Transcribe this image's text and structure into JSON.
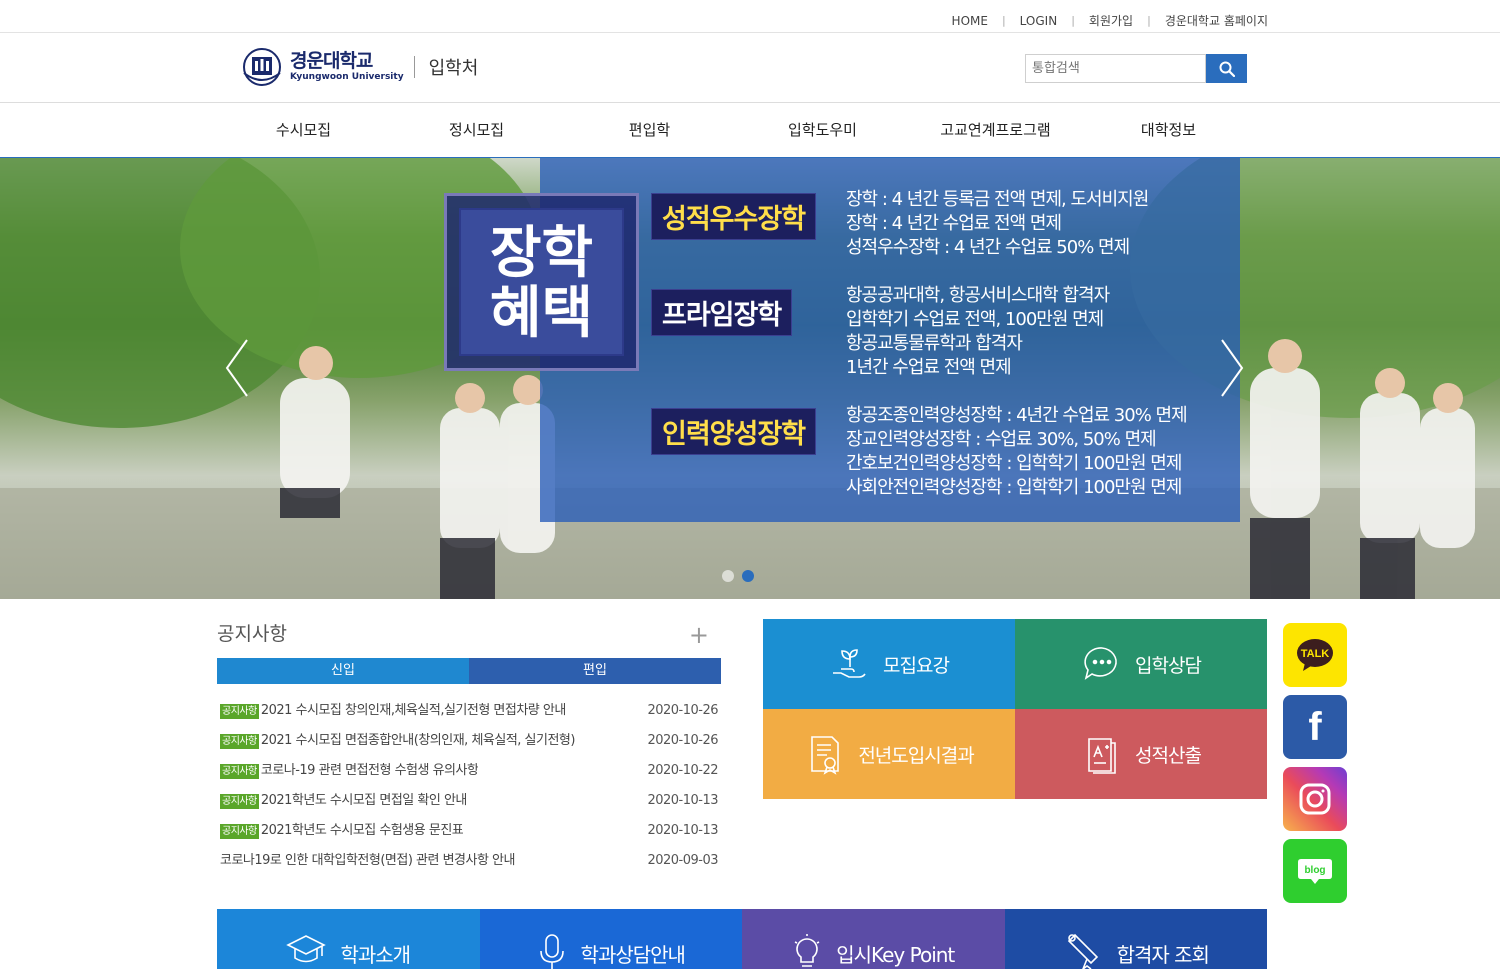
{
  "utility_nav": [
    "HOME",
    "LOGIN",
    "회원가입",
    "경운대학교 홈페이지"
  ],
  "logo": {
    "ko": "경운대학교",
    "en": "Kyungwoon University",
    "dept": "입학처"
  },
  "search": {
    "placeholder": "통합검색"
  },
  "gnb": [
    "수시모집",
    "정시모집",
    "편입학",
    "입학도우미",
    "고교연계프로그램",
    "대학정보"
  ],
  "hero": {
    "badge_line1": "장학",
    "badge_line2": "혜택",
    "sections": [
      {
        "title": "성적우수장학",
        "lines": [
          "장학 : 4 년간 등록금 전액 면제, 도서비지원",
          "장학 : 4 년간 수업료 전액 면제",
          "성적우수장학 : 4 년간 수업료 50% 면제"
        ]
      },
      {
        "title": "프라임장학",
        "lines": [
          "항공공과대학, 항공서비스대학 합격자",
          "입학학기 수업료 전액, 100만원 면제",
          "항공교통물류학과 합격자",
          "1년간 수업료 전액 면제"
        ]
      },
      {
        "title": "인력양성장학",
        "lines": [
          "항공조종인력양성장학 : 4년간 수업료 30% 면제",
          "장교인력양성장학 : 수업료 30%, 50% 면제",
          "간호보건인력양성장학 : 입학학기 100만원 면제",
          "사회안전인력양성장학 : 입학학기 100만원 면제"
        ]
      }
    ]
  },
  "notice": {
    "title": "공지사항",
    "more": "+",
    "tabs": [
      "신입",
      "편입"
    ],
    "tag": "공지사항",
    "items": [
      {
        "tagged": true,
        "title": "2021 수시모집 창의인재,체육실적,실기전형 면접차량 안내",
        "date": "2020-10-26"
      },
      {
        "tagged": true,
        "title": "2021 수시모집 면접종합안내(창의인재, 체육실적, 실기전형)",
        "date": "2020-10-26"
      },
      {
        "tagged": true,
        "title": "코로나-19 관련 면접전형 수험생 유의사항",
        "date": "2020-10-22"
      },
      {
        "tagged": true,
        "title": "2021학년도 수시모집 면접일 확인 안내",
        "date": "2020-10-13"
      },
      {
        "tagged": true,
        "title": "2021학년도 수시모집 수험생용 문진표",
        "date": "2020-10-13"
      },
      {
        "tagged": false,
        "title": "코로나19로 인한 대학입학전형(면접) 관련 변경사항 안내",
        "date": "2020-09-03"
      }
    ]
  },
  "tiles": [
    "모집요강",
    "입학상담",
    "전년도입시결과",
    "성적산출"
  ],
  "sns": {
    "kakao": "TALK",
    "facebook": "f",
    "blog": "blog"
  },
  "bottom": [
    "학과소개",
    "학과상담안내",
    "입시Key Point",
    "합격자 조회"
  ],
  "colors": {
    "primary": "#2a6dbd",
    "tab_new": "#1f88d0",
    "tab_transfer": "#2d5fae",
    "tag_green": "#5aa62a"
  }
}
